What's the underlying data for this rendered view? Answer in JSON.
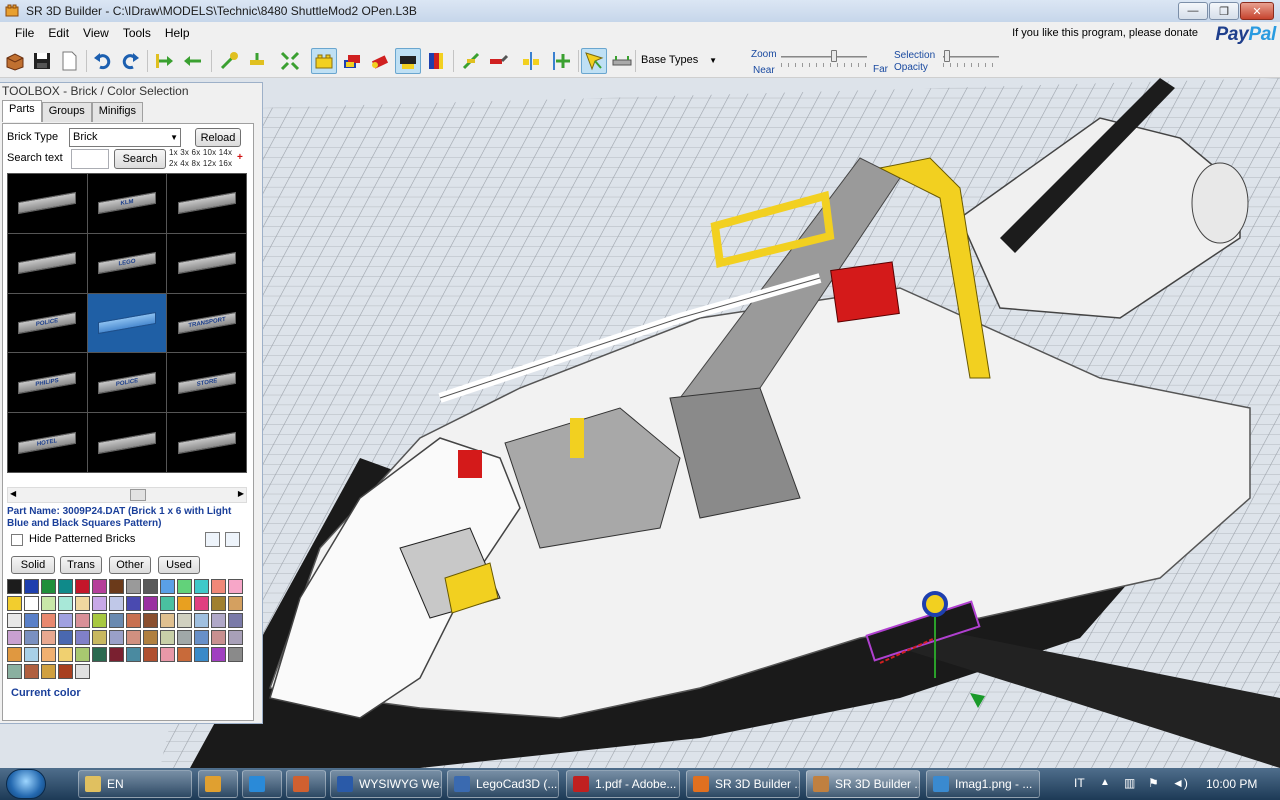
{
  "window": {
    "title": "SR 3D Builder - C:\\IDraw\\MODELS\\Technic\\8480 ShuttleMod2 OPen.L3B",
    "minimize": "—",
    "maximize": "❐",
    "close": "✕"
  },
  "menu": {
    "items": [
      "File",
      "Edit",
      "View",
      "Tools",
      "Help"
    ]
  },
  "donate": {
    "text": "If you like this program, please donate",
    "paypal_pay": "Pay",
    "paypal_pal": "Pal"
  },
  "toolbar": {
    "base_types": "Base Types",
    "zoom_label": "Zoom",
    "near_label": "Near",
    "far_label": "Far",
    "selection_label": "Selection",
    "opacity_label": "Opacity"
  },
  "toolbox": {
    "title": "TOOLBOX - Brick / Color Selection",
    "tabs": [
      "Parts",
      "Groups",
      "Minifigs"
    ],
    "brick_type_label": "Brick Type",
    "brick_type_value": "Brick",
    "reload": "Reload",
    "search_label": "Search text",
    "search_button": "Search",
    "multipliers_top": "1x  3x  6x  10x  14x",
    "multipliers_bottom": "2x  4x  8x  12x  16x",
    "bricks": [
      "",
      "KLM",
      "",
      "",
      "LEGO",
      "",
      "POLICE",
      "",
      "TRANSPORT",
      "PHILIPS",
      "POLICE",
      "STORE",
      "HOTEL",
      "",
      ""
    ],
    "part_name": "Part Name: 3009P24.DAT (Brick  1 x  6 with Light Blue and Black Squares Pattern)",
    "hide_patterned": "Hide Patterned Bricks",
    "color_buttons": [
      "Solid",
      "Trans",
      "Other",
      "Used"
    ],
    "current_color": "Current color"
  },
  "colors": [
    "#1c1c1c",
    "#1e3fae",
    "#1f8f3a",
    "#0f8a8a",
    "#c4162a",
    "#b53f9a",
    "#6b3a1a",
    "#9a9a9a",
    "#5a5a5a",
    "#5aa0e6",
    "#62d27a",
    "#3fc9c9",
    "#f08878",
    "#f7a6c8",
    "#f2cd2e",
    "#ffffff",
    "#c8e8a8",
    "#a8e8d8",
    "#f0d8a0",
    "#c8a8e8",
    "#c0c8e8",
    "#4a4ab0",
    "#9a30a0",
    "#4ac0a0",
    "#e8a020",
    "#e04080",
    "#a08030",
    "#d4a060",
    "#e8e8e8",
    "#5a80c8",
    "#e88870",
    "#a0a0e0",
    "#d89098",
    "#a8c840",
    "#6a8ab0",
    "#c87050",
    "#8a5030",
    "#e0c090",
    "#d0d0c0",
    "#a0c0e0",
    "#b0a8c8",
    "#7a7aa8",
    "#c8a0d0",
    "#7a90c0",
    "#e8a890",
    "#4a68b0",
    "#8080c8",
    "#c8b860",
    "#9aa0c8",
    "#d09080",
    "#b08040",
    "#c8d0a8",
    "#a0a8a8",
    "#6890c8",
    "#c89090",
    "#a8a0b8",
    "#e09840",
    "#a8d0e8",
    "#f0b070",
    "#f0d070",
    "#a8c870",
    "#2a6a50",
    "#7a2030",
    "#4a8aa0",
    "#b05030",
    "#e898a8",
    "#c86a3a",
    "#3a8ac8",
    "#a040c0",
    "#8a8a8a",
    "#8ab0a0",
    "#b06040",
    "#d0a040",
    "#a84020",
    "#e0e0e0"
  ],
  "taskbar": {
    "tasks": [
      {
        "label": "EN",
        "color": "#e0c060"
      },
      {
        "label": "",
        "color": "#e0a030"
      },
      {
        "label": "",
        "color": "#2a8ad8"
      },
      {
        "label": "",
        "color": "#d06030"
      },
      {
        "label": "WYSIWYG We...",
        "color": "#2a5aa8"
      },
      {
        "label": "LegoCad3D (...",
        "color": "#3a6ab0"
      },
      {
        "label": "1.pdf - Adobe...",
        "color": "#c02020"
      },
      {
        "label": "SR 3D Builder ...",
        "color": "#e07020"
      },
      {
        "label": "SR 3D Builder ...",
        "color": "#c08040"
      },
      {
        "label": "Imag1.png - ...",
        "color": "#3a8ad0"
      }
    ],
    "lang": "IT",
    "clock": "10:00 PM"
  }
}
